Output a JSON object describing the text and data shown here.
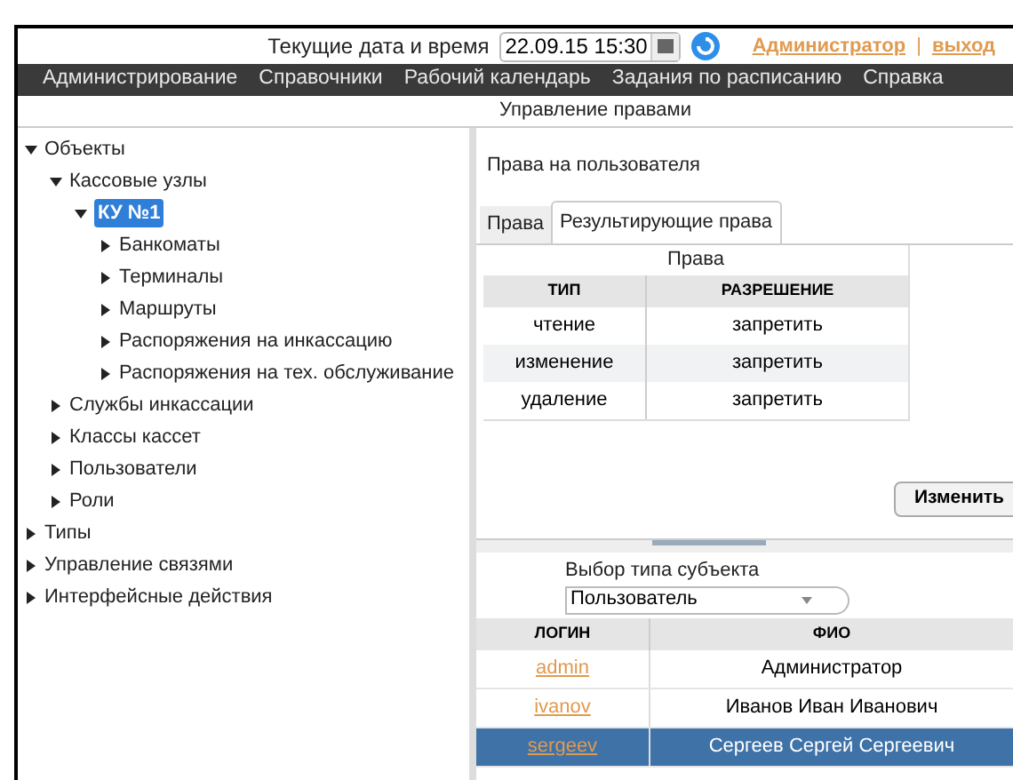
{
  "header": {
    "datetime_label": "Текущие дата и время",
    "datetime_value": "22.09.15 15:30",
    "user_link": "Администратор",
    "separator": "|",
    "logout_link": "выход"
  },
  "menu": [
    "Администрирование",
    "Справочники",
    "Рабочий календарь",
    "Задания по расписанию",
    "Справка"
  ],
  "page_title": "Управление правами",
  "tree": [
    {
      "label": "Объекты",
      "expanded": true,
      "selected": false,
      "children": [
        {
          "label": "Кассовые узлы",
          "expanded": true,
          "selected": false,
          "children": [
            {
              "label": "КУ №1",
              "expanded": true,
              "selected": true,
              "children": [
                {
                  "label": "Банкоматы",
                  "expanded": false,
                  "selected": false
                },
                {
                  "label": "Терминалы",
                  "expanded": false,
                  "selected": false
                },
                {
                  "label": "Маршруты",
                  "expanded": false,
                  "selected": false
                },
                {
                  "label": "Распоряжения на инкассацию",
                  "expanded": false,
                  "selected": false
                },
                {
                  "label": "Распоряжения на тех. обслуживание",
                  "expanded": false,
                  "selected": false
                }
              ]
            }
          ]
        },
        {
          "label": "Службы инкассации",
          "expanded": false,
          "selected": false
        },
        {
          "label": "Классы кассет",
          "expanded": false,
          "selected": false
        },
        {
          "label": "Пользователи",
          "expanded": false,
          "selected": false
        },
        {
          "label": "Роли",
          "expanded": false,
          "selected": false
        }
      ]
    },
    {
      "label": "Типы",
      "expanded": false,
      "selected": false
    },
    {
      "label": "Управление связями",
      "expanded": false,
      "selected": false
    },
    {
      "label": "Интерфейсные действия",
      "expanded": false,
      "selected": false
    }
  ],
  "rights_panel": {
    "heading": "Права на пользователя",
    "tabs": [
      {
        "label": "Права",
        "selected": false
      },
      {
        "label": "Результирующие права",
        "selected": true
      }
    ],
    "table": {
      "caption": "Права",
      "columns": [
        "ТИП",
        "РАЗРЕШЕНИЕ"
      ],
      "rows": [
        [
          "чтение",
          "запретить"
        ],
        [
          "изменение",
          "запретить"
        ],
        [
          "удаление",
          "запретить"
        ]
      ]
    },
    "button": "Изменить"
  },
  "subject_panel": {
    "select_label": "Выбор типа субъекта",
    "select_value": "Пользователь",
    "table": {
      "columns": [
        "ЛОГИН",
        "ФИО"
      ],
      "rows": [
        {
          "login": "admin",
          "name": "Администратор",
          "selected": false
        },
        {
          "login": "ivanov",
          "name": "Иванов Иван Иванович",
          "selected": false
        },
        {
          "login": "sergeev",
          "name": "Сергеев Сергей Сергеевич",
          "selected": true
        }
      ]
    }
  }
}
